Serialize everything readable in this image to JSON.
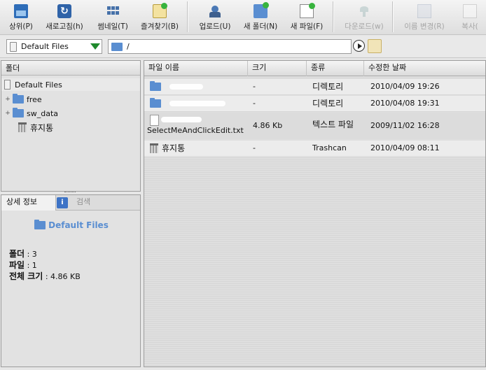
{
  "toolbar": {
    "buttons": [
      {
        "label": "상위(P)",
        "icon": "folder-up-icon",
        "enabled": true
      },
      {
        "label": "새로고침(h)",
        "icon": "refresh-icon",
        "enabled": true
      },
      {
        "label": "썸네일(T)",
        "icon": "thumbnail-icon",
        "enabled": true
      },
      {
        "label": "즐겨찾기(B)",
        "icon": "favorites-icon",
        "enabled": true
      },
      {
        "label": "업로드(U)",
        "icon": "upload-icon",
        "enabled": true
      },
      {
        "label": "새 폴더(N)",
        "icon": "new-folder-icon",
        "enabled": true
      },
      {
        "label": "새 파일(F)",
        "icon": "new-file-icon",
        "enabled": true
      },
      {
        "label": "다운로드(w)",
        "icon": "download-icon",
        "enabled": false
      },
      {
        "label": "이름 변경(R)",
        "icon": "rename-icon",
        "enabled": false
      },
      {
        "label": "복사(",
        "icon": "copy-icon",
        "enabled": false
      }
    ]
  },
  "address": {
    "drive": "Default Files",
    "path": "/"
  },
  "folder_panel": {
    "title": "폴더",
    "root": "Default Files",
    "items": [
      {
        "label": "free",
        "type": "folder",
        "expander": "+"
      },
      {
        "label": "sw_data",
        "type": "folder",
        "expander": "+"
      },
      {
        "label": "휴지통",
        "type": "trash",
        "expander": ""
      }
    ]
  },
  "details_panel": {
    "tab_details": "상세 정보",
    "tab_search": "검색",
    "info_icon_glyph": "i",
    "folder_name": "Default Files",
    "folders_label": "폴더",
    "folders_value": ": 3",
    "files_label": "파일",
    "files_value": ": 1",
    "size_label": "전체 크기",
    "size_value": ": 4.86 KB"
  },
  "file_list": {
    "columns": [
      "파일 이름",
      "크기",
      "종류",
      "수정한 날짜"
    ],
    "rows": [
      {
        "name": "",
        "size": "-",
        "kind": "디렉토리",
        "modified": "2010/04/09 19:26",
        "icon": "folder-icon"
      },
      {
        "name": "",
        "size": "-",
        "kind": "디렉토리",
        "modified": "2010/04/08 19:31",
        "icon": "folder-icon"
      },
      {
        "name": "SelectMeAndClickEdit.txt",
        "size": "4.86 Kb",
        "kind": "텍스트 파일",
        "modified": "2009/11/02 16:28",
        "icon": "file-icon"
      },
      {
        "name": "휴지통",
        "size": "-",
        "kind": "Trashcan",
        "modified": "2010/04/09 08:11",
        "icon": "trash-icon"
      }
    ]
  }
}
